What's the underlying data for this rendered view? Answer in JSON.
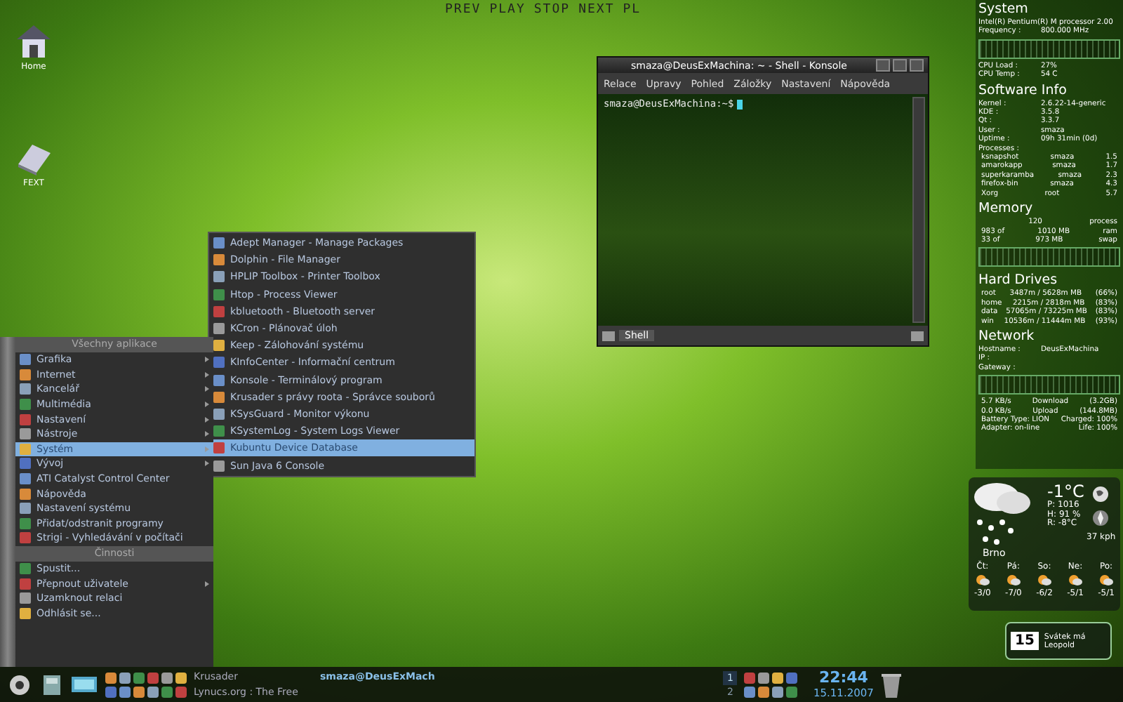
{
  "media_bar": {
    "buttons": [
      "PREV",
      "PLAY",
      "STOP",
      "NEXT",
      "PL"
    ]
  },
  "desktop_icons": [
    {
      "label": "Home"
    },
    {
      "label": "FEXT"
    }
  ],
  "konsole": {
    "title": "smaza@DeusExMachina: ~ - Shell - Konsole",
    "menu": [
      "Relace",
      "Upravy",
      "Pohled",
      "Záložky",
      "Nastavení",
      "Nápověda"
    ],
    "prompt": "smaza@DeusExMachina:~$",
    "tabs": [
      {
        "label": "Shell",
        "selected": true
      }
    ]
  },
  "start_menu": {
    "sections": [
      {
        "header": "Všechny aplikace",
        "items": [
          {
            "label": "Grafika",
            "submenu": true,
            "selected": false
          },
          {
            "label": "Internet",
            "submenu": true,
            "selected": false
          },
          {
            "label": "Kancelář",
            "submenu": true,
            "selected": false
          },
          {
            "label": "Multimédia",
            "submenu": true,
            "selected": false
          },
          {
            "label": "Nastavení",
            "submenu": true,
            "selected": false
          },
          {
            "label": "Nástroje",
            "submenu": true,
            "selected": false
          },
          {
            "label": "Systém",
            "submenu": true,
            "selected": true
          },
          {
            "label": "Vývoj",
            "submenu": true,
            "selected": false
          },
          {
            "label": "ATI Catalyst Control Center",
            "submenu": false,
            "selected": false
          },
          {
            "label": "Nápověda",
            "submenu": false,
            "selected": false
          },
          {
            "label": "Nastavení systému",
            "submenu": false,
            "selected": false
          },
          {
            "label": "Přidat/odstranit programy",
            "submenu": false,
            "selected": false
          },
          {
            "label": "Strigi - Vyhledávání v počítači",
            "submenu": false,
            "selected": false
          }
        ]
      },
      {
        "header": "Činnosti",
        "items": [
          {
            "label": "Spustit...",
            "submenu": false,
            "selected": false
          },
          {
            "label": "Přepnout uživatele",
            "submenu": true,
            "selected": false
          },
          {
            "label": "Uzamknout relaci",
            "submenu": false,
            "selected": false
          },
          {
            "label": "Odhlásit se...",
            "submenu": false,
            "selected": false
          }
        ]
      }
    ]
  },
  "submenu": {
    "items": [
      {
        "label": "Adept Manager - Manage Packages",
        "selected": false
      },
      {
        "label": "Dolphin - File Manager",
        "selected": false
      },
      {
        "label": "HPLIP Toolbox - Printer Toolbox",
        "selected": false
      },
      {
        "label": "Htop - Process Viewer",
        "selected": false
      },
      {
        "label": "kbluetooth - Bluetooth server",
        "selected": false
      },
      {
        "label": "KCron - Plánovač úloh",
        "selected": false
      },
      {
        "label": "Keep - Zálohování systému",
        "selected": false
      },
      {
        "label": "KInfoCenter - Informační centrum",
        "selected": false
      },
      {
        "label": "Konsole - Terminálový program",
        "selected": false
      },
      {
        "label": "Krusader s právy roota - Správce souborů",
        "selected": false
      },
      {
        "label": "KSysGuard - Monitor výkonu",
        "selected": false
      },
      {
        "label": "KSystemLog - System Logs Viewer",
        "selected": false
      },
      {
        "label": "Kubuntu Device Database",
        "selected": true
      },
      {
        "label": "Sun Java 6 Console",
        "selected": false
      }
    ]
  },
  "sidebar": {
    "sections": [
      {
        "title": "System",
        "lines": [
          {
            "kind": "text",
            "cells": [
              "Intel(R) Pentium(R) M processor 2.00"
            ]
          },
          {
            "kind": "pair",
            "cells": [
              "Frequency :",
              "800.000  MHz"
            ]
          },
          {
            "kind": "graph"
          },
          {
            "kind": "pair",
            "cells": [
              "CPU Load :",
              "27%"
            ]
          },
          {
            "kind": "pair",
            "cells": [
              "CPU Temp :",
              "54 C"
            ]
          }
        ]
      },
      {
        "title": "Software Info",
        "lines": [
          {
            "kind": "pair",
            "cells": [
              "Kernel :",
              "2.6.22-14-generic"
            ]
          },
          {
            "kind": "pair",
            "cells": [
              "KDE :",
              "3.5.8"
            ]
          },
          {
            "kind": "pair",
            "cells": [
              "Qt :",
              "3.3.7"
            ]
          },
          {
            "kind": "pair",
            "cells": [
              "User :",
              "smaza"
            ]
          },
          {
            "kind": "pair",
            "cells": [
              "Uptime :",
              "09h 31min (0d)"
            ]
          },
          {
            "kind": "text",
            "cells": [
              "Processes :"
            ]
          },
          {
            "kind": "row",
            "cells": [
              "ksnapshot",
              "smaza",
              "1.5"
            ]
          },
          {
            "kind": "row",
            "cells": [
              "amarokapp",
              "smaza",
              "1.7"
            ]
          },
          {
            "kind": "row",
            "cells": [
              "superkaramba",
              "smaza",
              "2.3"
            ]
          },
          {
            "kind": "row",
            "cells": [
              "firefox-bin",
              "smaza",
              "4.3"
            ]
          },
          {
            "kind": "row",
            "cells": [
              "Xorg",
              "root",
              "5.7"
            ]
          }
        ]
      },
      {
        "title": "Memory",
        "lines": [
          {
            "kind": "row",
            "cells": [
              "",
              "120",
              "process"
            ]
          },
          {
            "kind": "row",
            "cells": [
              "983  of",
              "1010 MB",
              "ram"
            ]
          },
          {
            "kind": "row",
            "cells": [
              "33  of",
              "973 MB",
              "swap"
            ]
          },
          {
            "kind": "graph"
          }
        ]
      },
      {
        "title": "Hard Drives",
        "lines": [
          {
            "kind": "row",
            "cells": [
              "root",
              "3487m / 5628m MB",
              "(66%)"
            ]
          },
          {
            "kind": "row",
            "cells": [
              "home",
              "2215m / 2818m MB",
              "(83%)"
            ]
          },
          {
            "kind": "row",
            "cells": [
              "data",
              "57065m / 73225m MB",
              "(83%)"
            ]
          },
          {
            "kind": "row",
            "cells": [
              "win",
              "10536m / 11444m MB",
              "(93%)"
            ]
          }
        ]
      },
      {
        "title": "Network",
        "lines": [
          {
            "kind": "pair",
            "cells": [
              "Hostname :",
              "DeusExMachina"
            ]
          },
          {
            "kind": "text",
            "cells": [
              "IP :"
            ]
          },
          {
            "kind": "text",
            "cells": [
              "Gateway :"
            ]
          },
          {
            "kind": "graph"
          },
          {
            "kind": "row",
            "cells": [
              "5.7 KB/s",
              "Download",
              "(3.2GB)"
            ]
          },
          {
            "kind": "row",
            "cells": [
              "0.0 KB/s",
              "Upload",
              "(144.8MB)"
            ]
          },
          {
            "kind": "row",
            "cells": [
              "Battery Type: LION",
              "Charged: 100%"
            ]
          },
          {
            "kind": "row",
            "cells": [
              "Adapter:  on-line",
              "Life:  100%"
            ]
          }
        ]
      }
    ]
  },
  "weather": {
    "temperature": "-1°C",
    "details": [
      "P: 1016",
      "H: 91 %",
      "R: -8°C"
    ],
    "wind": "37 kph",
    "city": "Brno",
    "forecast": [
      {
        "day": "Čt:",
        "temp": "-3/0"
      },
      {
        "day": "Pá:",
        "temp": "-7/0"
      },
      {
        "day": "So:",
        "temp": "-6/2"
      },
      {
        "day": "Ne:",
        "temp": "-5/1"
      },
      {
        "day": "Po:",
        "temp": "-5/1"
      }
    ]
  },
  "calendar": {
    "day": "15",
    "note": "Svátek má Leopold"
  },
  "taskbar": {
    "tasks": [
      {
        "label": "Krusader",
        "selected": false
      },
      {
        "label": "Lynucs.org : The Free",
        "selected": false
      },
      {
        "label": "smaza@DeusExMach",
        "selected": true
      }
    ],
    "desktops": [
      {
        "label": "1",
        "selected": true
      },
      {
        "label": "2",
        "selected": false
      }
    ],
    "time": "22:44",
    "date": "15.11.2007"
  }
}
